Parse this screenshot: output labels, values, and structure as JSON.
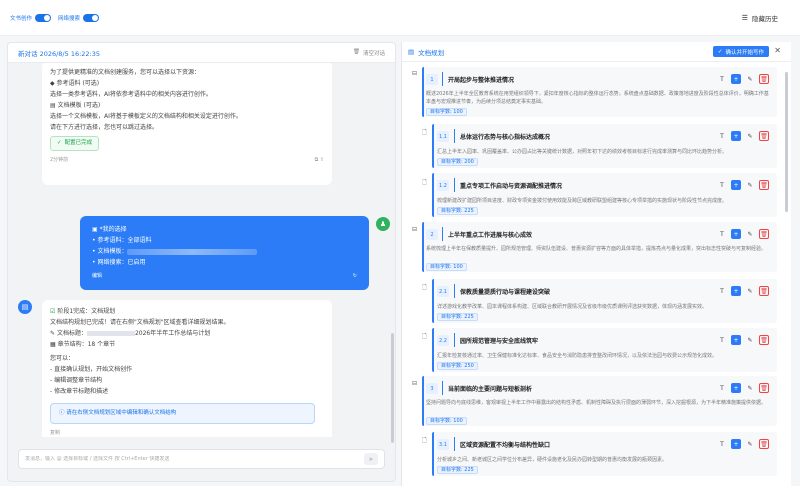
{
  "topbar": {
    "toggle_doc": "文书创作",
    "toggle_web": "网络搜索",
    "history_label": "隐藏历史"
  },
  "chat": {
    "title": "新对话 2026/8/5 16:22:35",
    "clear_label": "清空对话",
    "intro_line": "为了提供更精准的文档创建服务，您可以选择以下资源：",
    "ref_title": "参考语料 (可选)",
    "ref_desc": "选择一类参考语料，AI将依参考语料中的相关内容进行创作。",
    "tpl_title": "文档模板 (可选)",
    "tpl_desc": "选择一个文档模板，AI将基于模板定义的文档结构和相关设定进行创作。",
    "next_hint": "请在下方进行选择，您也可以跳过选择。",
    "config_done": "配置已完成",
    "time1": "2分钟前",
    "user_msg": {
      "title": "*我的选择",
      "ref": "参考语料：全部语料",
      "tpl": "文档模板：",
      "web": "网络搜索：已启用",
      "footer": "编辑"
    },
    "ai2": {
      "title": "阶段1完成：文档规划",
      "line1": "文档结构规划已完成！请在右侧\"文档规划\"区域查看详细规划结果。",
      "doc_title_prefix": "文档标题：",
      "doc_title_suffix": "2026年半年工作总结与计划",
      "chapters": "章节结构：18 个章节",
      "you_can": "您可以：",
      "opt1": "- 直接确认规划，开始文档创作",
      "opt2": "- 编辑调整章节结构",
      "opt3": "- 修改章节标题和描述",
      "info": "请在右侧文档规划区域中编辑和确认文档结构",
      "footer": "复制"
    },
    "input_placeholder": "发消息，输入 @ 选择目标或 / 选择文件 按 Ctrl+Enter 快捷发送"
  },
  "plan": {
    "title": "文档规划",
    "confirm_btn": "确认并开始写作",
    "nodes": [
      {
        "num": "1",
        "title": "开局起步与整体推进情况",
        "desc": "概述2026年上半年全区教育系统在用党组织领导下，紧扣年度核心指标的整体运行态势。系统盘点基础数据、政策落地进度及阶段性总体评价，明确工作基本盘与宏观推进节奏，为后续分项总结奠定事实基础。",
        "tag": "目标字数: 100"
      },
      {
        "num": "1.1",
        "title": "总体运行态势与核心指标达成概况",
        "desc": "汇总上半年入园率、巩固覆盖率、公办园占比等关键统计数据，对照年初下达的绩效考核目标进行完成率测算与同比环比趋势分析。",
        "tag": "目标字数: 200"
      },
      {
        "num": "1.2",
        "title": "重点专项工作启动与资源调配推进情况",
        "desc": "梳理新建改扩建园所项目进度、财政专项资金拨付使用效能及跨区域教研联盟组建等核心专项举措的实施现状与阶段性节点完成度。",
        "tag": "目标字数: 225"
      },
      {
        "num": "2",
        "title": "上半年重点工作进展与核心成效",
        "desc": "系统梳理上半年在保教质量提升、园所规范管理、师资队伍建设、普惠资源扩容等方面的具体举措，提炼亮点与量化成果，突出标志性突破与可复制经验。",
        "tag": "目标字数: 100"
      },
      {
        "num": "2.1",
        "title": "保教质量提质行动与课程建设突破",
        "desc": "详述游戏化教学改革、园本课程体系构建、区域联合教研开展情况及省级市级优质课例评选获奖数据，体现内涵发展实效。",
        "tag": "目标字数: 225"
      },
      {
        "num": "2.2",
        "title": "园所规范管理与安全底线筑牢",
        "desc": "汇报年检复核通过率、卫生保健标准化达标率、食品安全与消防隐患排查整改闭环情况，以及依法治园与收费公示规范化成效。",
        "tag": "目标字数: 250"
      },
      {
        "num": "3",
        "title": "当前面临的主要问题与短板剖析",
        "desc": "坚持问题导向与底线思维，客观审视上半年工作中暴露出的结构性矛盾、机制性障碍及执行层面的薄弱环节，深入挖掘根源，为下半年精准施策提供依据。",
        "tag": "目标字数: 100"
      },
      {
        "num": "3.1",
        "title": "区域资源配置不均衡与结构性缺口",
        "desc": "分析城乡之间、新老城区之间学位分布差异，硬件设施老化及民办园转型期的普惠均衡发展的瓶颈因素。",
        "tag": "目标字数: 225"
      }
    ]
  }
}
